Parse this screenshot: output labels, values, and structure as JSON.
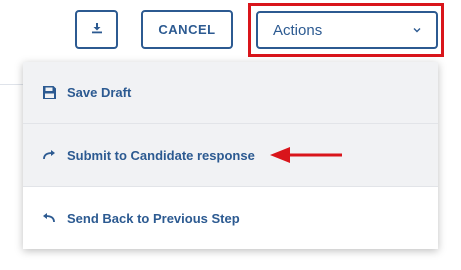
{
  "toolbar": {
    "download_icon": "download-icon",
    "cancel_label": "CANCEL",
    "actions_label": "Actions",
    "actions_icon": "chevron-down-icon"
  },
  "menu": {
    "items": [
      {
        "label": "Save Draft",
        "icon": "save-icon"
      },
      {
        "label": "Submit to Candidate response",
        "icon": "redo-arrow-icon"
      },
      {
        "label": "Send Back to Previous Step",
        "icon": "undo-arrow-icon"
      }
    ]
  },
  "annotation": {
    "highlight_color": "#d9151b",
    "arrow_color": "#d9151b",
    "arrow_target": "Submit to Candidate response"
  },
  "colors": {
    "accent": "#2c5a91"
  }
}
